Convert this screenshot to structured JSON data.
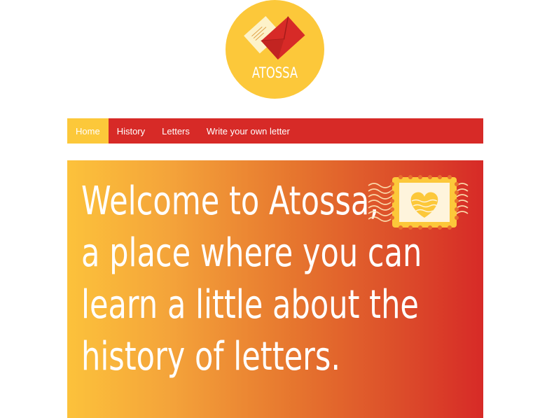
{
  "logo": {
    "text": "ATOSSA",
    "icon": "envelope-icon",
    "colors": {
      "circle": "#fcc83a",
      "envelope": "#d72a27",
      "paper": "#fdf2c9"
    }
  },
  "nav": {
    "items": [
      {
        "label": "Home",
        "active": true
      },
      {
        "label": "History",
        "active": false
      },
      {
        "label": "Letters",
        "active": false
      },
      {
        "label": "Write your own letter",
        "active": false
      }
    ],
    "colors": {
      "bar": "#d72a27",
      "active": "#fcc83a"
    }
  },
  "hero": {
    "lines": [
      "Welcome to Atossa,",
      "a place where you can",
      "learn a little about the",
      "history of letters."
    ],
    "icon": "heart-stamp-icon",
    "gradient": [
      "#fcc23b",
      "#d72a27"
    ]
  }
}
